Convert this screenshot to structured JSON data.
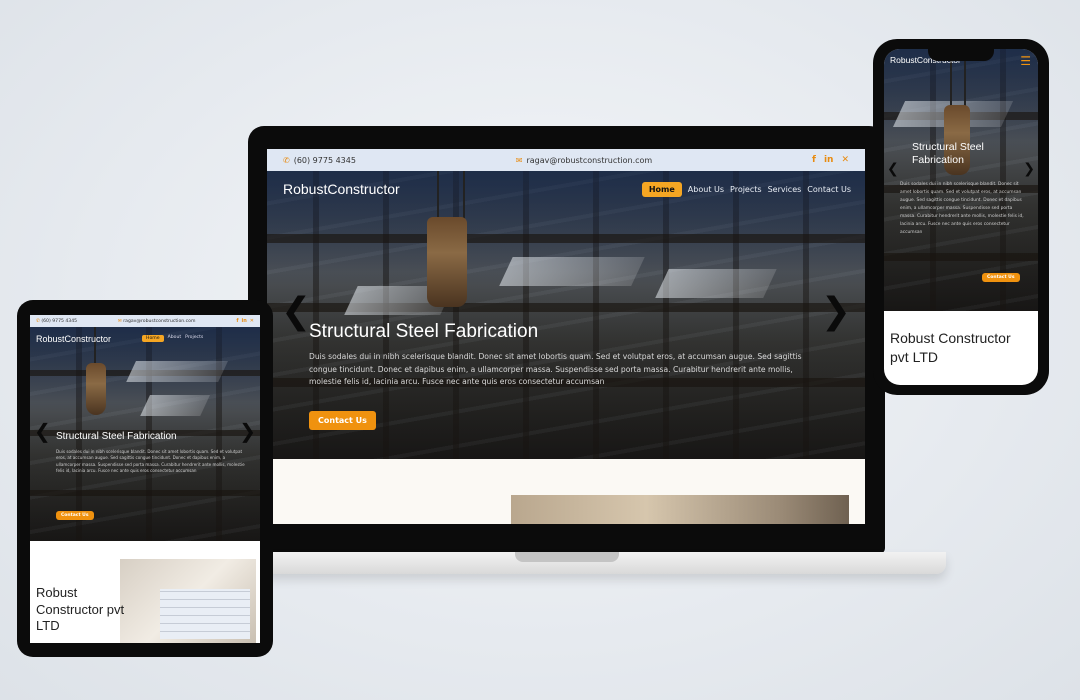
{
  "site": {
    "brand": "RobustConstructor",
    "phone": "(60) 9775 4345",
    "email": "ragav@robustconstruction.com"
  },
  "nav": {
    "home": "Home",
    "about": "About Us",
    "projects": "Projects",
    "services": "Services",
    "contact": "Contact Us"
  },
  "tablet_nav": {
    "home": "Home",
    "about": "About",
    "projects": "Projects"
  },
  "hero": {
    "title": "Structural Steel Fabrication",
    "body": "Duis sodales dui in nibh scelerisque blandit. Donec sit amet lobortis quam. Sed et volutpat eros, at accumsan augue. Sed sagittis congue tincidunt. Donec et dapibus enim, a ullamcorper massa. Suspendisse sed porta massa. Curabitur hendrerit ante mollis, molestie felis id, lacinia arcu. Fusce nec ante quis eros consectetur accumsan",
    "cta": "Contact Us"
  },
  "about": {
    "title_tablet": "Robust Constructor pvt LTD",
    "title_phone": "Robust Constructor pvt LTD"
  },
  "icons": [
    "phone-icon",
    "mail-icon",
    "facebook-icon",
    "linkedin-icon",
    "close-icon",
    "chevron-left-icon",
    "chevron-right-icon",
    "hamburger-menu-icon"
  ],
  "colors": {
    "accent": "#f0920f",
    "topbar": "#dfe7f3",
    "device": "#0b0b0b"
  }
}
